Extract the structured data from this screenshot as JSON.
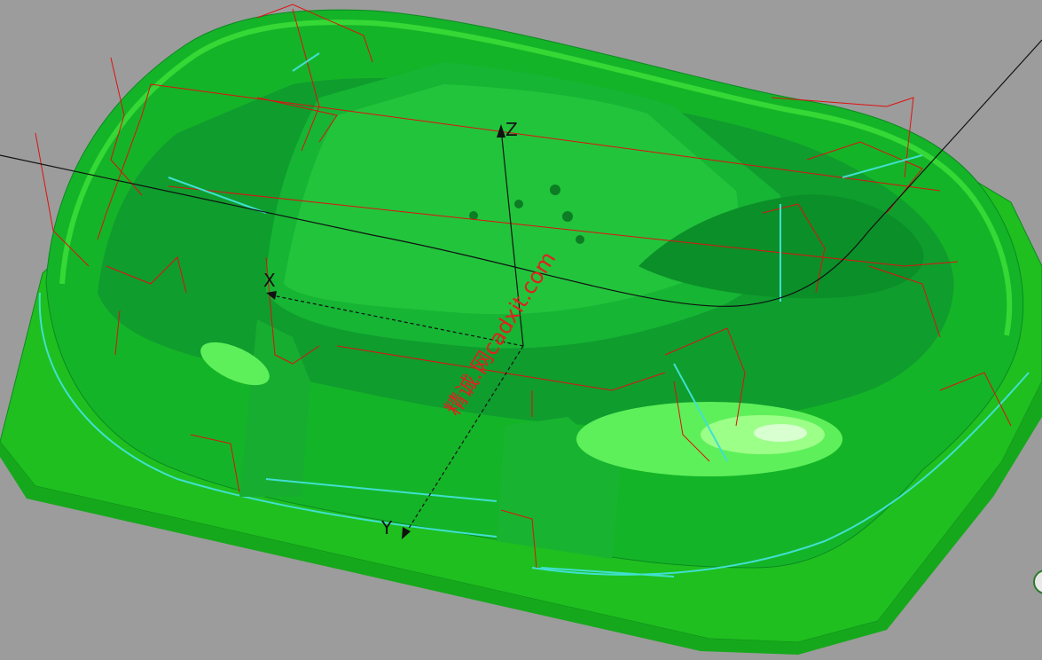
{
  "viewport": {
    "axes": {
      "x_label": "X",
      "y_label": "Y",
      "z_label": "Z"
    },
    "watermark": "精诚.网cadxit.com",
    "colors": {
      "background": "#9c9c9c",
      "part_base": "#19c219",
      "part_dark": "#0e9a2e",
      "part_light": "#30d830",
      "highlight": "#66ff44",
      "toolpath_red": "#e01010",
      "edge_cyan": "#40e0d0",
      "trajectory_black": "#111111"
    }
  }
}
